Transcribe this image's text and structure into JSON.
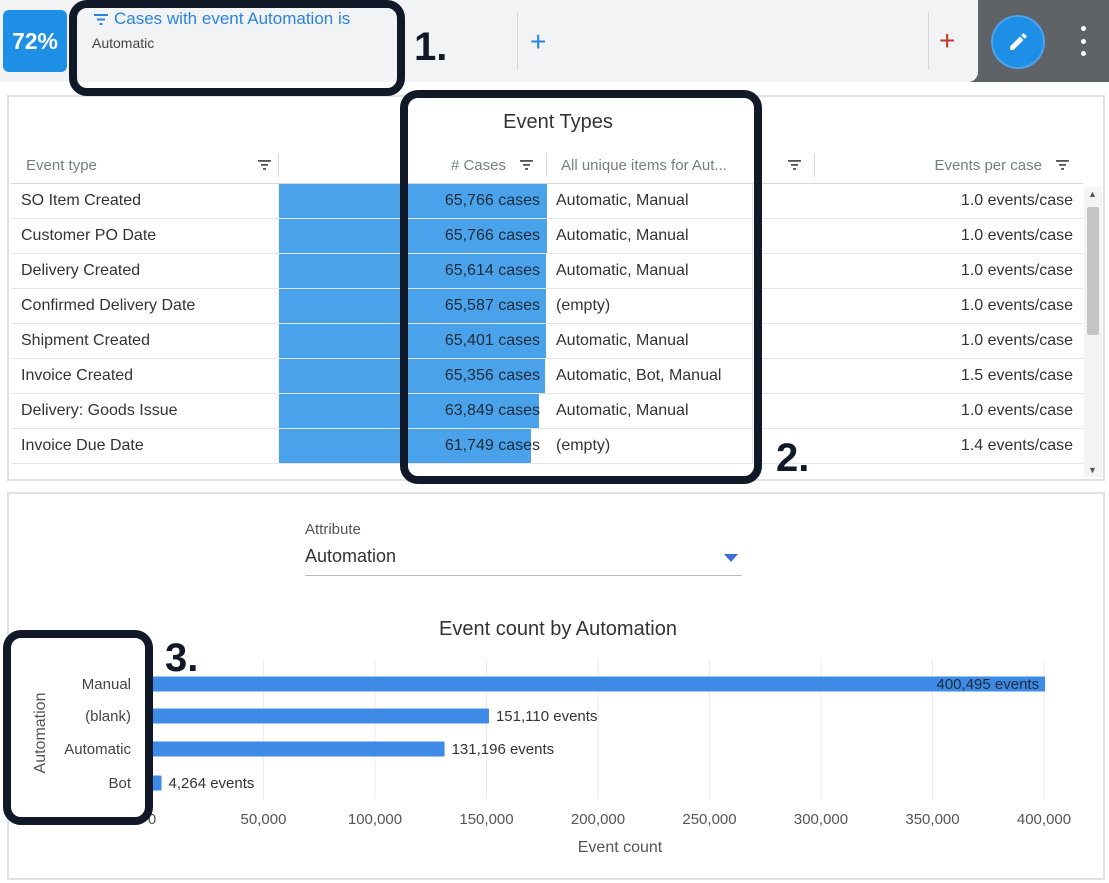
{
  "topbar": {
    "percent_badge": "72%",
    "filter_title": "Cases with event Automation is",
    "filter_value": "Automatic"
  },
  "table": {
    "title": "Event Types",
    "columns": [
      "Event type",
      "# Cases",
      "All unique items for Aut...",
      "Events per case"
    ],
    "max_cases": 65766,
    "rows": [
      {
        "event_type": "SO Item Created",
        "cases_value": 65766,
        "cases": "65,766 cases",
        "items": "Automatic, Manual",
        "events_per_case": "1.0 events/case"
      },
      {
        "event_type": "Customer PO Date",
        "cases_value": 65766,
        "cases": "65,766 cases",
        "items": "Automatic, Manual",
        "events_per_case": "1.0 events/case"
      },
      {
        "event_type": "Delivery Created",
        "cases_value": 65614,
        "cases": "65,614 cases",
        "items": "Automatic, Manual",
        "events_per_case": "1.0 events/case"
      },
      {
        "event_type": "Confirmed Delivery Date",
        "cases_value": 65587,
        "cases": "65,587 cases",
        "items": "(empty)",
        "events_per_case": "1.0 events/case"
      },
      {
        "event_type": "Shipment Created",
        "cases_value": 65401,
        "cases": "65,401 cases",
        "items": "Automatic, Manual",
        "events_per_case": "1.0 events/case"
      },
      {
        "event_type": "Invoice Created",
        "cases_value": 65356,
        "cases": "65,356 cases",
        "items": "Automatic, Bot, Manual",
        "events_per_case": "1.5 events/case"
      },
      {
        "event_type": "Delivery: Goods Issue",
        "cases_value": 63849,
        "cases": "63,849 cases",
        "items": "Automatic, Manual",
        "events_per_case": "1.0 events/case"
      },
      {
        "event_type": "Invoice Due Date",
        "cases_value": 61749,
        "cases": "61,749 cases",
        "items": "(empty)",
        "events_per_case": "1.4 events/case"
      }
    ]
  },
  "attribute_selector": {
    "label": "Attribute",
    "value": "Automation"
  },
  "chart_data": {
    "type": "bar",
    "orientation": "horizontal",
    "title": "Event count by Automation",
    "xlabel": "Event count",
    "ylabel": "Automation",
    "categories": [
      "Manual",
      "(blank)",
      "Automatic",
      "Bot"
    ],
    "values": [
      400495,
      151110,
      131196,
      4264
    ],
    "value_labels": [
      "400,495 events",
      "151,110 events",
      "131,196 events",
      "4,264 events"
    ],
    "xlim": [
      0,
      400000
    ],
    "x_ticks": [
      0,
      50000,
      100000,
      150000,
      200000,
      250000,
      300000,
      350000,
      400000
    ],
    "x_tick_labels": [
      "0",
      "50,000",
      "100,000",
      "150,000",
      "200,000",
      "250,000",
      "300,000",
      "350,000",
      "400,000"
    ],
    "grid": true,
    "bar_color": "#3d8be6"
  },
  "annotations": [
    "1.",
    "2.",
    "3."
  ]
}
